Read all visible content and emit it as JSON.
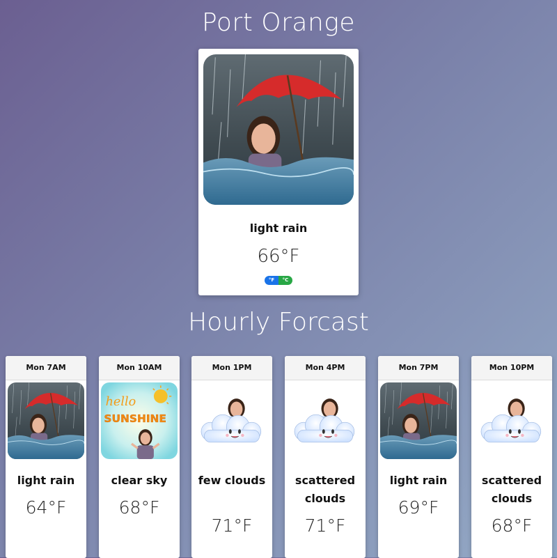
{
  "city": "Port Orange",
  "current": {
    "description": "light rain",
    "temperature": "66°F",
    "icon": "rain-umbrella-image",
    "units": [
      "°F",
      "°C"
    ]
  },
  "hourly_title": "Hourly Forcast",
  "hourly": [
    {
      "time": "Mon 7AM",
      "description": "light rain",
      "temperature": "64°F",
      "icon": "rain-umbrella-image"
    },
    {
      "time": "Mon 10AM",
      "description": "clear sky",
      "temperature": "68°F",
      "icon": "hello-sunshine-image"
    },
    {
      "time": "Mon 1PM",
      "description": "few clouds",
      "temperature": "71°F",
      "icon": "cloud-image"
    },
    {
      "time": "Mon 4PM",
      "description": "scattered clouds",
      "temperature": "71°F",
      "icon": "cloud-image"
    },
    {
      "time": "Mon 7PM",
      "description": "light rain",
      "temperature": "69°F",
      "icon": "rain-umbrella-image"
    },
    {
      "time": "Mon 10PM",
      "description": "scattered clouds",
      "temperature": "68°F",
      "icon": "cloud-image"
    }
  ],
  "image_text": {
    "sunshine_line1": "hello",
    "sunshine_line2": "SUNSHINE"
  },
  "colors": {
    "fahrenheit_btn": "#1a73e8",
    "celsius_btn": "#28a745",
    "umbrella": "#d62b2b"
  }
}
